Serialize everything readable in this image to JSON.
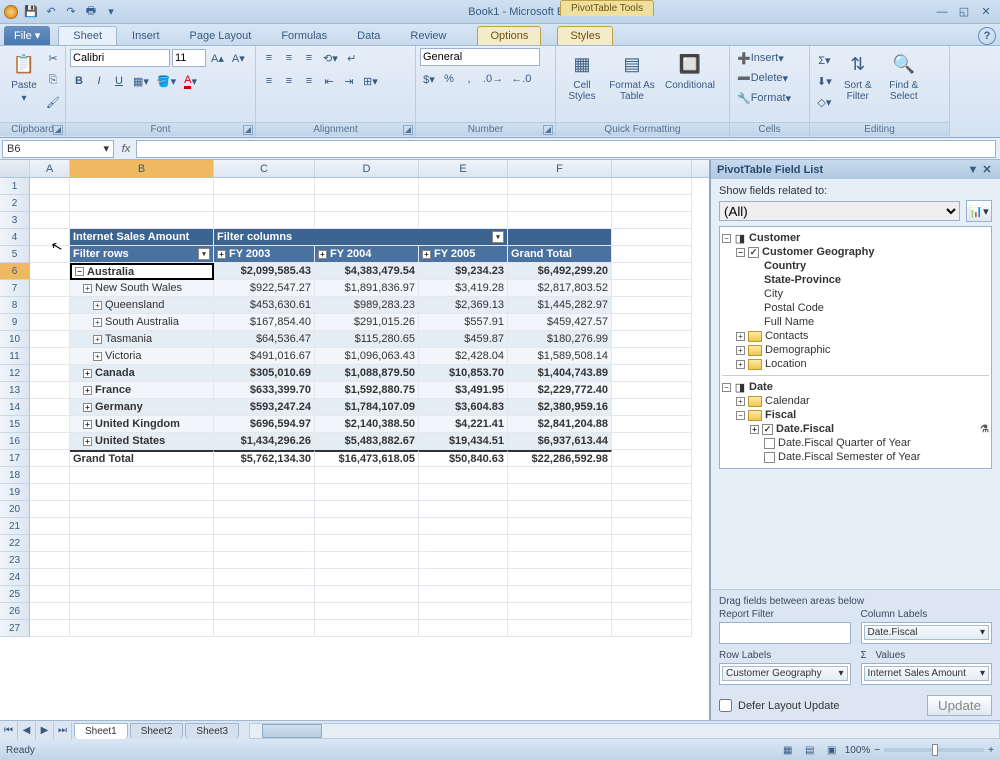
{
  "titlebar": {
    "doc": "Book1",
    "app": "Microsoft Excel",
    "context_tools": "PivotTable Tools"
  },
  "menu": {
    "file": "File",
    "tabs": [
      "Sheet",
      "Insert",
      "Page Layout",
      "Formulas",
      "Data",
      "Review"
    ],
    "active": "Sheet",
    "context_tabs": [
      "Options",
      "Styles"
    ]
  },
  "ribbon": {
    "groups": {
      "clipboard": {
        "label": "Clipboard",
        "paste": "Paste"
      },
      "font": {
        "label": "Font",
        "name": "Calibri",
        "size": "11",
        "bold": "B",
        "italic": "I",
        "underline": "U"
      },
      "alignment": {
        "label": "Alignment"
      },
      "number": {
        "label": "Number",
        "format": "General"
      },
      "quickfmt": {
        "label": "Quick Formatting",
        "cellstyles": "Cell Styles",
        "formattable": "Format As Table",
        "conditional": "Conditional"
      },
      "cells": {
        "label": "Cells",
        "insert": "Insert",
        "delete": "Delete",
        "format": "Format"
      },
      "editing": {
        "label": "Editing",
        "sortfilter": "Sort & Filter",
        "findselect": "Find & Select"
      }
    }
  },
  "fx": {
    "name": "B6",
    "formula": ""
  },
  "columns": [
    "A",
    "B",
    "C",
    "D",
    "E",
    "F"
  ],
  "pivot": {
    "corner": "Internet Sales Amount",
    "filter_cols": "Filter columns",
    "filter_rows": "Filter rows",
    "col_headers": [
      "FY 2003",
      "FY 2004",
      "FY 2005",
      "Grand Total"
    ],
    "rows": [
      {
        "label": "Australia",
        "indent": 0,
        "exp": "-",
        "active": true,
        "vals": [
          "$2,099,585.43",
          "$4,383,479.54",
          "$9,234.23",
          "$6,492,299.20"
        ],
        "bold": true
      },
      {
        "label": "New South Wales",
        "indent": 1,
        "exp": "+",
        "vals": [
          "$922,547.27",
          "$1,891,836.97",
          "$3,419.28",
          "$2,817,803.52"
        ]
      },
      {
        "label": "Queensland",
        "indent": 2,
        "exp": "+",
        "vals": [
          "$453,630.61",
          "$989,283.23",
          "$2,369.13",
          "$1,445,282.97"
        ]
      },
      {
        "label": "South Australia",
        "indent": 2,
        "exp": "+",
        "vals": [
          "$167,854.40",
          "$291,015.26",
          "$557.91",
          "$459,427.57"
        ]
      },
      {
        "label": "Tasmania",
        "indent": 2,
        "exp": "+",
        "vals": [
          "$64,536.47",
          "$115,280.65",
          "$459.87",
          "$180,276.99"
        ]
      },
      {
        "label": "Victoria",
        "indent": 2,
        "exp": "+",
        "vals": [
          "$491,016.67",
          "$1,096,063.43",
          "$2,428.04",
          "$1,589,508.14"
        ]
      },
      {
        "label": "Canada",
        "indent": 1,
        "exp": "+",
        "vals": [
          "$305,010.69",
          "$1,088,879.50",
          "$10,853.70",
          "$1,404,743.89"
        ],
        "bold": true
      },
      {
        "label": "France",
        "indent": 1,
        "exp": "+",
        "vals": [
          "$633,399.70",
          "$1,592,880.75",
          "$3,491.95",
          "$2,229,772.40"
        ],
        "bold": true
      },
      {
        "label": "Germany",
        "indent": 1,
        "exp": "+",
        "vals": [
          "$593,247.24",
          "$1,784,107.09",
          "$3,604.83",
          "$2,380,959.16"
        ],
        "bold": true
      },
      {
        "label": "United Kingdom",
        "indent": 1,
        "exp": "+",
        "vals": [
          "$696,594.97",
          "$2,140,388.50",
          "$4,221.41",
          "$2,841,204.88"
        ],
        "bold": true
      },
      {
        "label": "United States",
        "indent": 1,
        "exp": "+",
        "vals": [
          "$1,434,296.26",
          "$5,483,882.67",
          "$19,434.51",
          "$6,937,613.44"
        ],
        "bold": true
      }
    ],
    "grand_total": {
      "label": "Grand Total",
      "vals": [
        "$5,762,134.30",
        "$16,473,618.05",
        "$50,840.63",
        "$22,286,592.98"
      ]
    }
  },
  "fieldlist": {
    "title": "PivotTable Field List",
    "show_label": "Show fields related to:",
    "show_value": "(All)",
    "tree": {
      "customer": "Customer",
      "cust_geo": "Customer Geography",
      "country": "Country",
      "state": "State-Province",
      "city": "City",
      "postal": "Postal Code",
      "fullname": "Full Name",
      "contacts": "Contacts",
      "demographic": "Demographic",
      "location": "Location",
      "date": "Date",
      "calendar": "Calendar",
      "fiscal": "Fiscal",
      "datefiscal": "Date.Fiscal",
      "fq": "Date.Fiscal Quarter of Year",
      "fs": "Date.Fiscal Semester of Year"
    },
    "areas": {
      "drag_label": "Drag fields between areas below",
      "report_filter": "Report Filter",
      "column_labels": "Column Labels",
      "row_labels": "Row Labels",
      "values": "Values",
      "sigma": "Σ",
      "col_chip": "Date.Fiscal",
      "row_chip": "Customer Geography",
      "val_chip": "Internet Sales Amount"
    },
    "defer": "Defer Layout Update",
    "update": "Update"
  },
  "sheets": {
    "tabs": [
      "Sheet1",
      "Sheet2",
      "Sheet3"
    ],
    "active": "Sheet1"
  },
  "status": {
    "ready": "Ready",
    "zoom": "100%"
  }
}
